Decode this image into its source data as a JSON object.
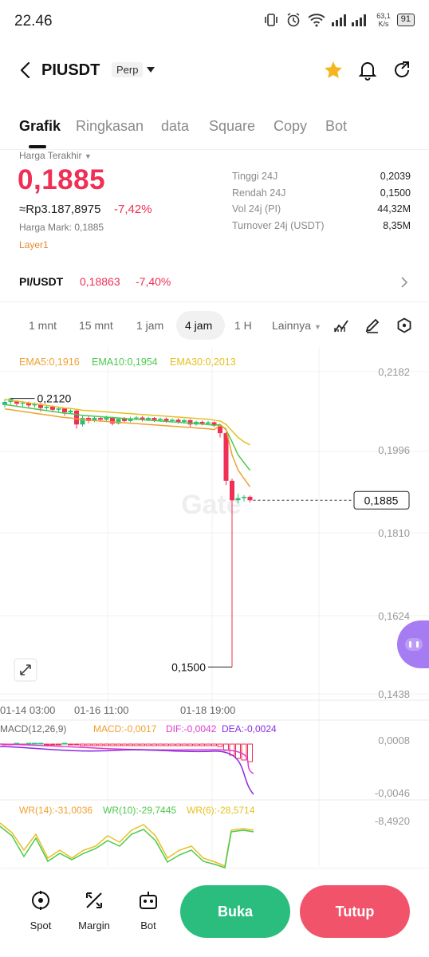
{
  "status_bar": {
    "time": "22.46",
    "speed_value": "63,1",
    "speed_unit": "K/s",
    "battery": "91"
  },
  "header": {
    "pair": "PIUSDT",
    "badge": "Perp"
  },
  "tabs": [
    {
      "label": "Grafik",
      "active": true
    },
    {
      "label": "Ringkasan",
      "active": false
    },
    {
      "label": "data",
      "active": false
    },
    {
      "label": "Square",
      "active": false
    },
    {
      "label": "Copy",
      "active": false
    },
    {
      "label": "Bot",
      "active": false
    }
  ],
  "price": {
    "last_label": "Harga Terakhir",
    "last": "0,1885",
    "rupiah": "≈Rp3.187,8975",
    "change": "-7,42%",
    "mark": "Harga Mark: 0,1885",
    "tag": "Layer1"
  },
  "stats": [
    {
      "label": "Tinggi 24J",
      "value": "0,2039"
    },
    {
      "label": "Rendah 24J",
      "value": "0,1500"
    },
    {
      "label": "Vol 24j (PI)",
      "value": "44,32M"
    },
    {
      "label": "Turnover 24j (USDT)",
      "value": "8,35M"
    }
  ],
  "spot": {
    "pair": "PI/USDT",
    "price": "0,18863",
    "change": "-7,40%"
  },
  "intervals": [
    {
      "label": "1 mnt",
      "active": false
    },
    {
      "label": "15 mnt",
      "active": false
    },
    {
      "label": "1 jam",
      "active": false
    },
    {
      "label": "4 jam",
      "active": true
    },
    {
      "label": "1 H",
      "active": false
    },
    {
      "label": "Lainnya",
      "active": false
    }
  ],
  "chart": {
    "ema_labels": [
      "EMA5:0,1916",
      "EMA10:0,1954",
      "EMA30:0,2013"
    ],
    "y_ticks": [
      "0,2182",
      "0,1996",
      "0,1810",
      "0,1624",
      "0,1438"
    ],
    "x_ticks": [
      "01-14 03:00",
      "01-16 11:00",
      "01-18 19:00"
    ],
    "high_marker": "0,2120",
    "low_marker": "0,1500",
    "current_price": "0,1885",
    "macd_labels": [
      "MACD(12,26,9)",
      "MACD:-0,0017",
      "DIF:-0,0042",
      "DEA:-0,0024"
    ],
    "macd_ticks": [
      "0,0008",
      "-0,0046"
    ],
    "wr_labels": [
      "WR(14):-31,0036",
      "WR(10):-29,7445",
      "WR(6):-28,5714"
    ],
    "wr_tick": "-8,4920",
    "watermark": "Gate",
    "colors": {
      "up": "#2bbd7e",
      "down": "#ef2f55",
      "ema5": "#f0a030",
      "ema10": "#4cc94c",
      "ema30": "#e6c020",
      "dif": "#e03ad0",
      "dea": "#8a2be2"
    }
  },
  "bottom": {
    "items": [
      {
        "label": "Spot",
        "icon": "spot-icon"
      },
      {
        "label": "Margin",
        "icon": "margin-icon"
      },
      {
        "label": "Bot",
        "icon": "bot-icon"
      }
    ],
    "buy": "Buka",
    "sell": "Tutup"
  }
}
